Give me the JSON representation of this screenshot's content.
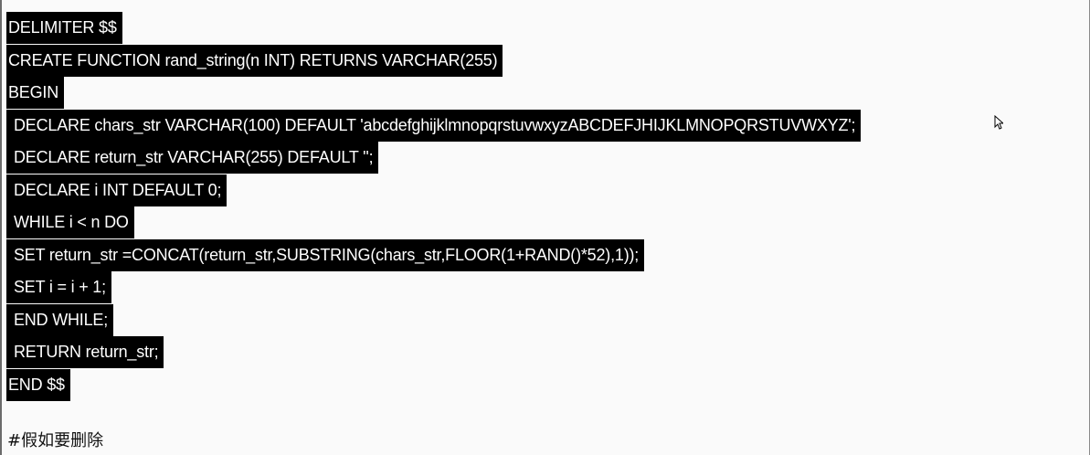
{
  "code_lines": [
    "DELIMITER $$",
    "CREATE FUNCTION rand_string(n INT) RETURNS VARCHAR(255)",
    "BEGIN",
    "DECLARE chars_str VARCHAR(100) DEFAULT 'abcdefghijklmnopqrstuvwxyzABCDEFJHIJKLMNOPQRSTUVWXYZ';",
    "DECLARE return_str VARCHAR(255) DEFAULT '';",
    "DECLARE i INT DEFAULT 0;",
    "WHILE i < n DO",
    "SET return_str =CONCAT(return_str,SUBSTRING(chars_str,FLOOR(1+RAND()*52),1));",
    "SET i = i + 1;",
    "END WHILE;",
    "RETURN return_str;",
    "END $$"
  ],
  "comment": "#假如要删除",
  "icons": {
    "cursor": "mouse-pointer-icon"
  },
  "colors": {
    "selection_bg": "#000000",
    "selection_text": "#ffffff",
    "page_bg": "#fafafa"
  }
}
